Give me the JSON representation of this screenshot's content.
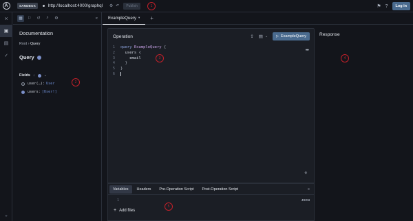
{
  "topbar": {
    "sandbox_label": "SANDBOX",
    "url": "http://localhost:4000/graphql",
    "publish_label": "Publish",
    "login_label": "Log in"
  },
  "doc": {
    "title": "Documentation",
    "breadcrumb_root": "Root",
    "breadcrumb_sep": "›",
    "breadcrumb_current": "Query",
    "section_title": "Query",
    "fields_label": "Fields",
    "fields": [
      {
        "name": "user(…)",
        "type": "User"
      },
      {
        "name": "users",
        "type": "[User!]"
      }
    ]
  },
  "tabs": {
    "active_label": "ExampleQuery",
    "add_label": "+"
  },
  "operation": {
    "title": "Operation",
    "run_label": "ExampleQuery",
    "lines": [
      "1",
      "2",
      "3",
      "4",
      "5",
      "6"
    ],
    "code": {
      "kw": "query",
      "name": "ExampleQuery",
      "open": "{",
      "field1": "users",
      "field2": "email",
      "close": "}"
    }
  },
  "variables": {
    "tabs": [
      "Variables",
      "Headers",
      "Pre-Operation Script",
      "Post-Operation Script"
    ],
    "line": "1",
    "format_label": "JSON",
    "add_files_label": "Add files"
  },
  "response": {
    "title": "Response"
  },
  "markers": [
    "1",
    "2",
    "3",
    "4",
    "5"
  ],
  "colors": {
    "accent": "#4a6b8f",
    "marker": "#c4202a",
    "background": "#13151b",
    "panel": "#1b1e25"
  }
}
